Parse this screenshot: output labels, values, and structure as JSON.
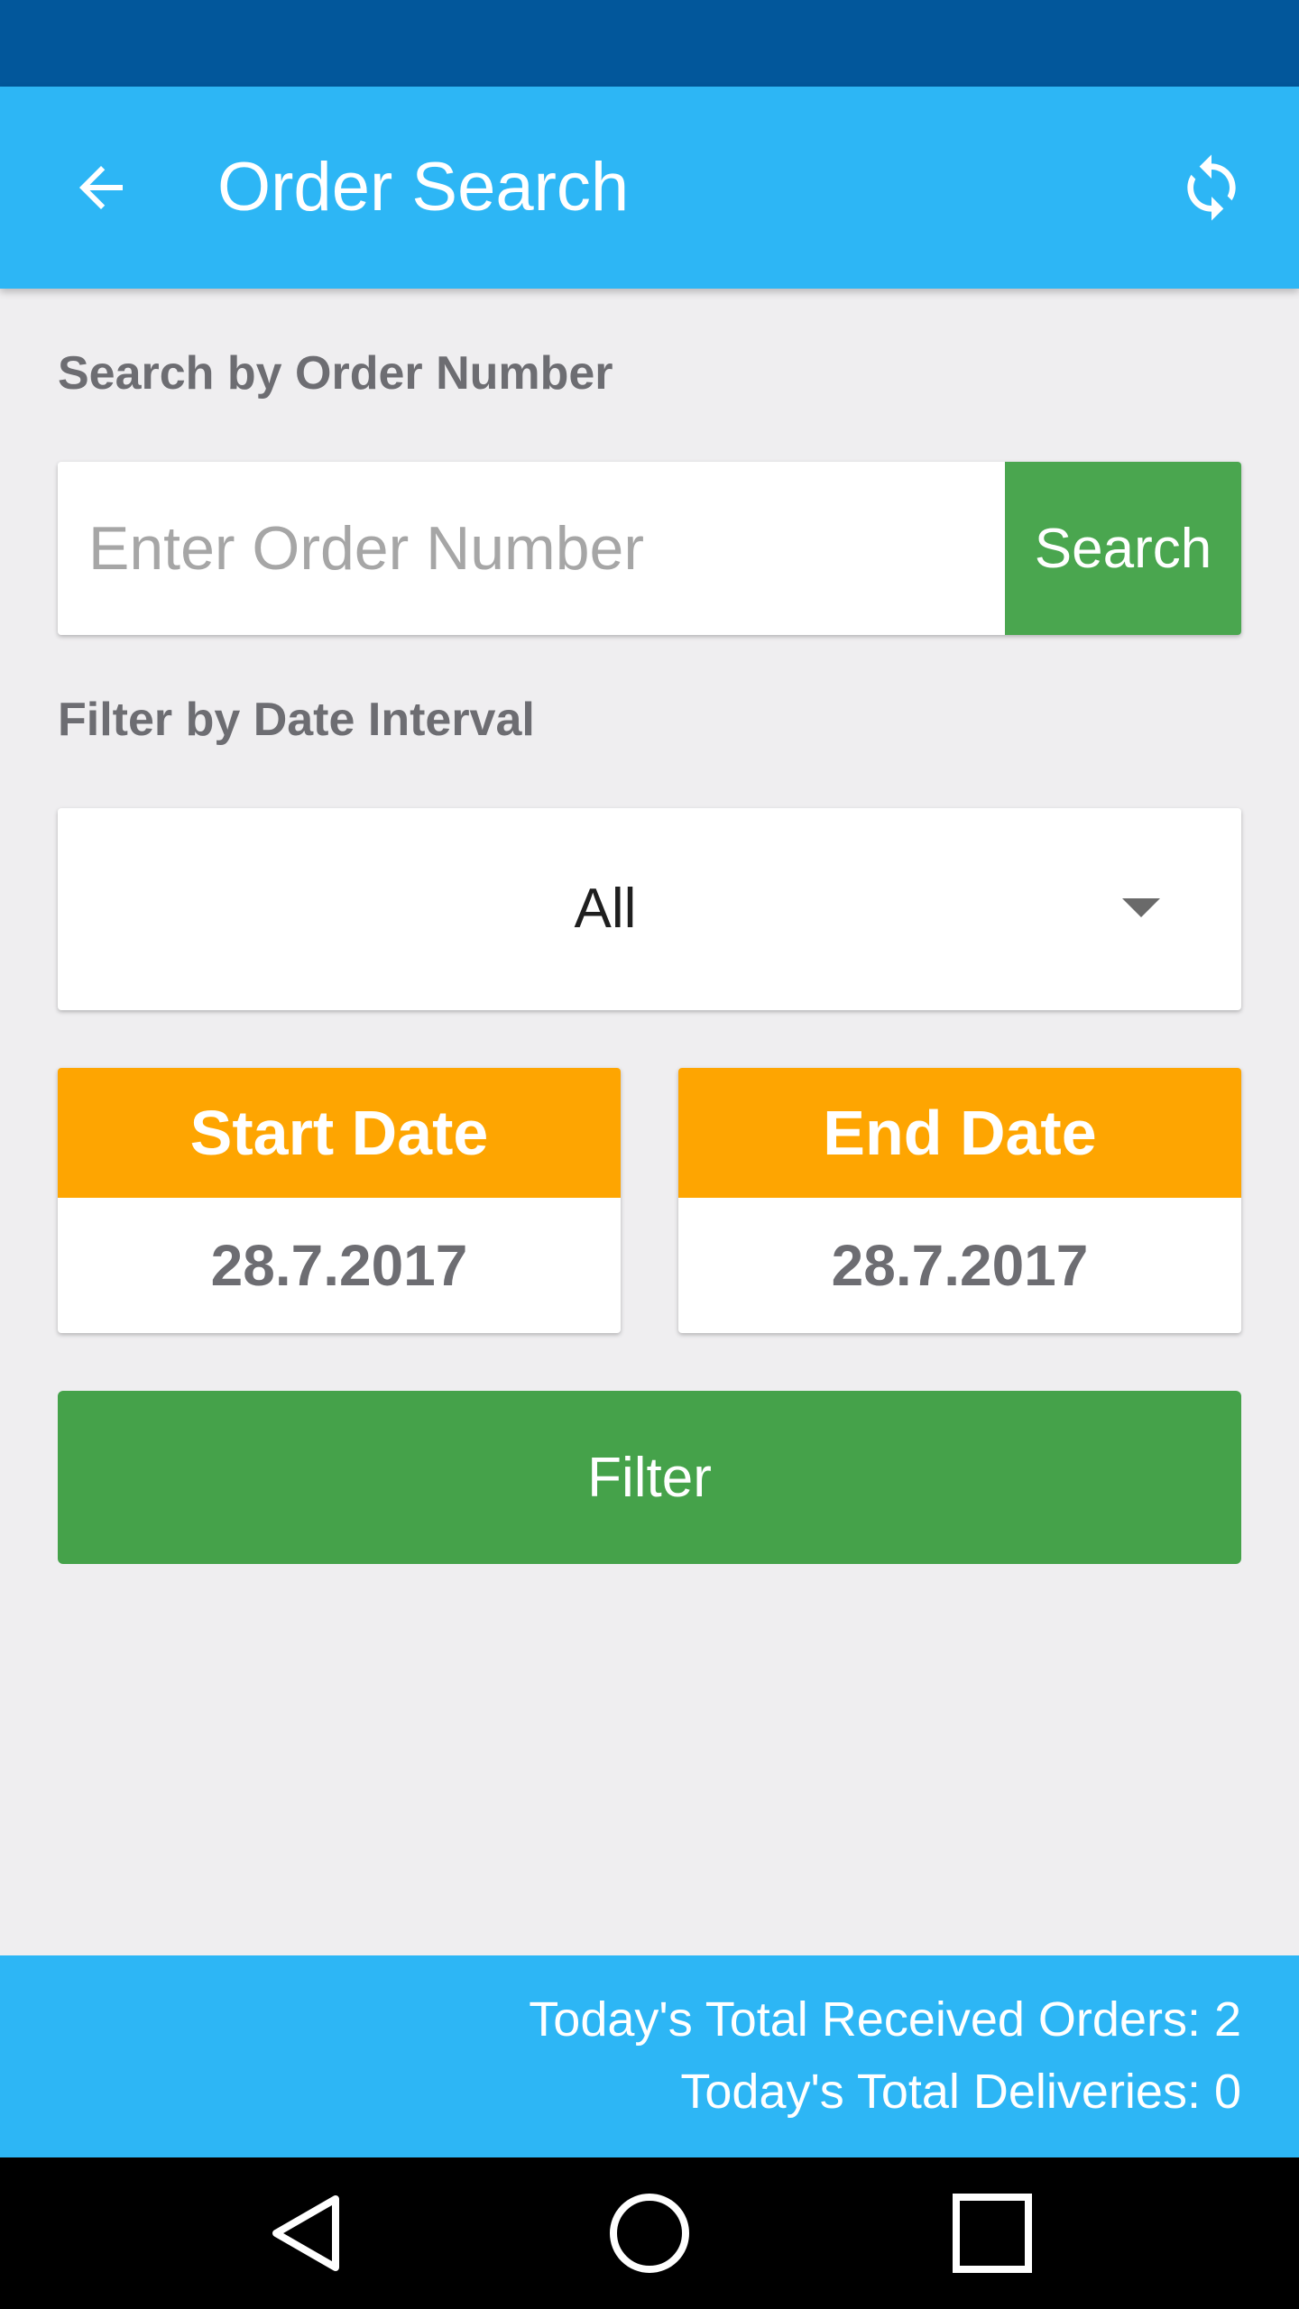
{
  "app_bar": {
    "title": "Order Search",
    "back_icon": "arrow-left-icon",
    "refresh_icon": "refresh-icon"
  },
  "order_search": {
    "label": "Search by Order Number",
    "placeholder": "Enter Order Number",
    "value": "",
    "search_label": "Search"
  },
  "date_filter": {
    "label": "Filter by Date Interval",
    "selected_interval": "All",
    "start_date": {
      "label": "Start Date",
      "value": "28.7.2017"
    },
    "end_date": {
      "label": "End Date",
      "value": "28.7.2017"
    },
    "filter_label": "Filter"
  },
  "footer": {
    "received_orders": "Today's Total Received Orders: 2",
    "deliveries": "Today's Total Deliveries: 0"
  },
  "nav": {
    "back_icon": "nav-back-triangle-icon",
    "home_icon": "nav-home-circle-icon",
    "recents_icon": "nav-recents-square-icon"
  },
  "colors": {
    "status_bar": "#02579b",
    "app_bar": "#2db6f5",
    "green": "#45a24a",
    "orange": "#fea501",
    "background": "#efeef0"
  }
}
